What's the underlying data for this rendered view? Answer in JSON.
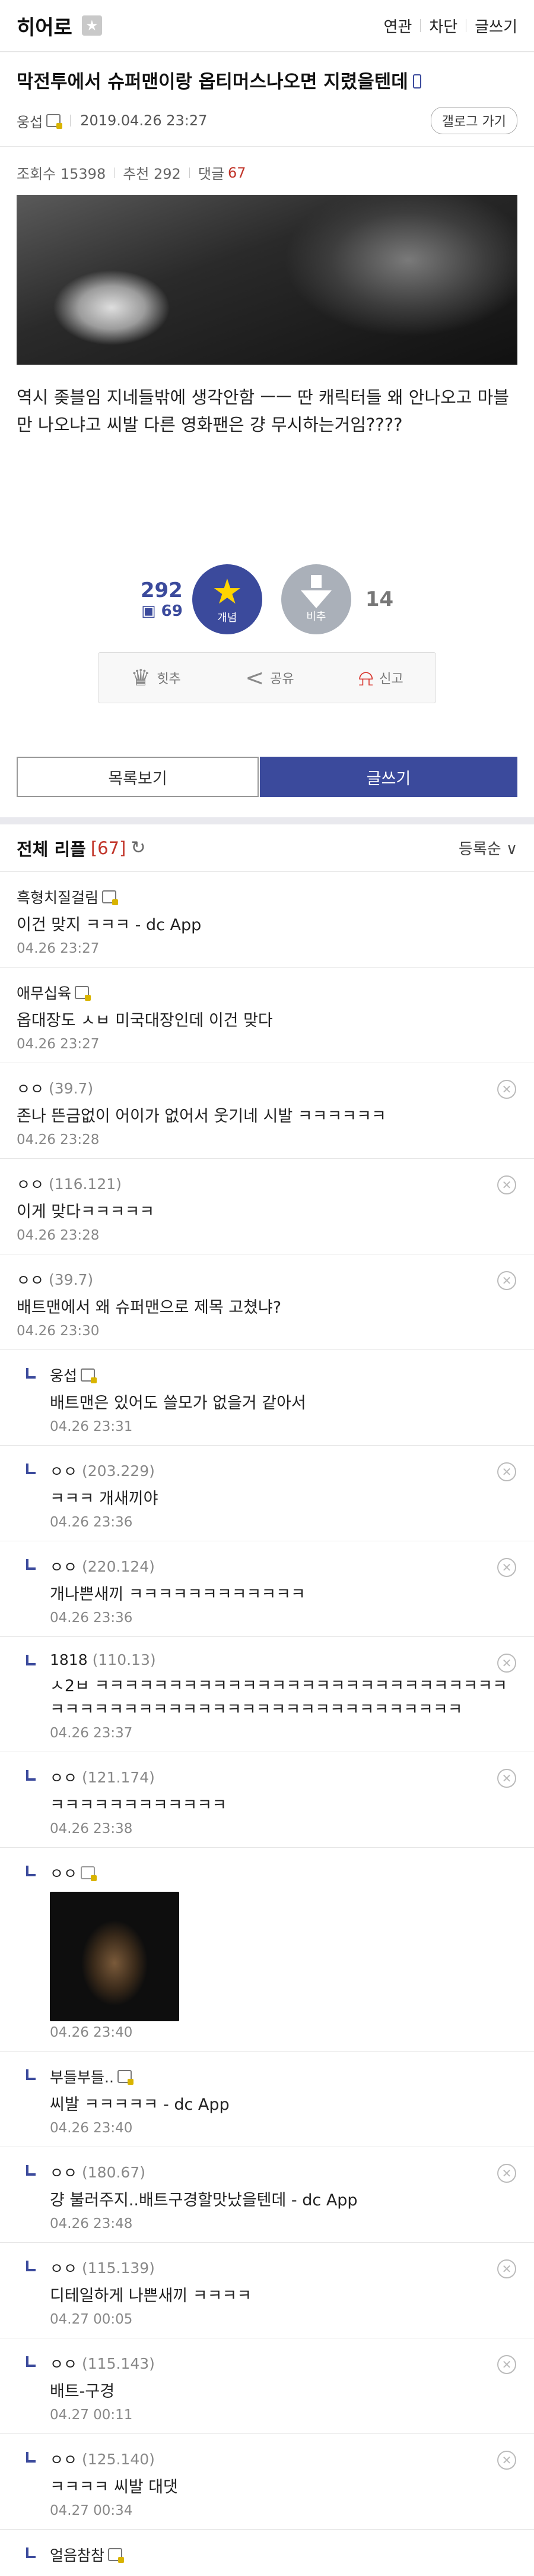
{
  "header": {
    "gallery_name": "히어로",
    "menu": [
      "연관",
      "차단",
      "글쓰기"
    ]
  },
  "post": {
    "title": "막전투에서 슈퍼맨이랑 옵티머스나오면 지렸을텐데",
    "author": "웅섭",
    "date": "2019.04.26 23:27",
    "gallery_button": "갤로그 가기",
    "views_label": "조회수 15398",
    "recommend_label": "추천 292",
    "comments_label": "댓글",
    "comments_count": "67",
    "body": "역시 좆블임 지네들밖에 생각안함 ㅡㅡ 딴 캐릭터들 왜 안나오고 마블만 나오냐고 씨발 다른 영화팬은 걍 무시하는거임????"
  },
  "vote": {
    "up_count": "292",
    "up_fixed": "69",
    "up_label": "개념",
    "down_label": "비추",
    "down_count": "14"
  },
  "actions": {
    "hit": "힛추",
    "share": "공유",
    "report": "신고"
  },
  "buttons": {
    "list": "목록보기",
    "write": "글쓰기"
  },
  "comments_header": {
    "title": "전체 리플",
    "count": "[67]",
    "sort": "등록순 ∨"
  },
  "comments": [
    {
      "nick": "흑형치질걸림",
      "ip": "",
      "memo": "이건 맞지 ㅋㅋㅋ - dc App",
      "date": "04.26 23:27"
    },
    {
      "nick": "애무십육",
      "ip": "",
      "memo": "옵대장도 ㅅㅂ 미국대장인데 이건 맞다",
      "date": "04.26 23:27"
    },
    {
      "nick": "ㅇㅇ",
      "ip": "(39.7)",
      "memo": "존나 뜬금없이 어이가 없어서 웃기네 시발 ㅋㅋㅋㅋㅋㅋ",
      "date": "04.26 23:28"
    },
    {
      "nick": "ㅇㅇ",
      "ip": "(116.121)",
      "memo": "이게 맞다ㅋㅋㅋㅋㅋ",
      "date": "04.26 23:28"
    },
    {
      "nick": "ㅇㅇ",
      "ip": "(39.7)",
      "memo": "배트맨에서 왜 슈퍼맨으로 제목 고쳤냐?",
      "date": "04.26 23:30"
    },
    {
      "nick": "웅섭",
      "ip": "",
      "memo": "배트맨은 있어도 쓸모가 없을거 같아서",
      "date": "04.26 23:31"
    },
    {
      "nick": "ㅇㅇ",
      "ip": "(203.229)",
      "memo": "ㅋㅋㅋ 개새끼야",
      "date": "04.26 23:36"
    },
    {
      "nick": "ㅇㅇ",
      "ip": "(220.124)",
      "memo": "개나쁜새끼 ㅋㅋㅋㅋㅋㅋㅋㅋㅋㅋㅋㅋ",
      "date": "04.26 23:36"
    },
    {
      "nick": "1818",
      "ip": "(110.13)",
      "memo": "ㅅ2ㅂ ㅋㅋㅋㅋㅋㅋㅋㅋㅋㅋㅋㅋㅋㅋㅋㅋㅋㅋㅋㅋㅋㅋㅋㅋㅋㅋㅋㅋㅋㅋㅋㅋㅋㅋㅋㅋㅋㅋㅋㅋㅋㅋㅋㅋㅋㅋㅋㅋㅋㅋㅋㅋㅋㅋㅋㅋ",
      "date": "04.26 23:37"
    },
    {
      "nick": "ㅇㅇ",
      "ip": "(121.174)",
      "memo": "ㅋㅋㅋㅋㅋㅋㅋㅋㅋㅋㅋㅋ",
      "date": "04.26 23:38"
    },
    {
      "nick": "ㅇㅇ",
      "ip": "",
      "memo": "",
      "date": "04.26 23:40"
    },
    {
      "nick": "부들부들..",
      "ip": "",
      "memo": "씨발 ㅋㅋㅋㅋㅋ - dc App",
      "date": "04.26 23:40"
    },
    {
      "nick": "ㅇㅇ",
      "ip": "(180.67)",
      "memo": "걍 불러주지..배트구경할맛났을텐데 - dc App",
      "date": "04.26 23:48"
    },
    {
      "nick": "ㅇㅇ",
      "ip": "(115.139)",
      "memo": "디테일하게 나쁜새끼 ㅋㅋㅋㅋ",
      "date": "04.27 00:05"
    },
    {
      "nick": "ㅇㅇ",
      "ip": "(115.143)",
      "memo": "배트-구경",
      "date": "04.27 00:11"
    },
    {
      "nick": "ㅇㅇ",
      "ip": "(125.140)",
      "memo": "ㅋㅋㅋㅋ 씨발 대댓",
      "date": "04.27 00:34"
    },
    {
      "nick": "얼음참참",
      "ip": "",
      "memo": "",
      "date": ""
    }
  ]
}
